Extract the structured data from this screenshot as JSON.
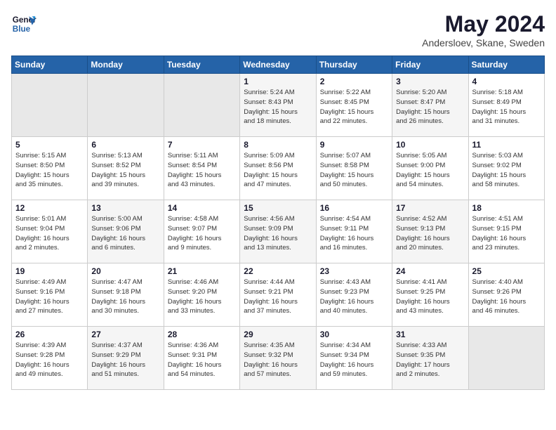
{
  "logo": {
    "line1": "General",
    "line2": "Blue"
  },
  "title": "May 2024",
  "location": "Andersloev, Skane, Sweden",
  "weekdays": [
    "Sunday",
    "Monday",
    "Tuesday",
    "Wednesday",
    "Thursday",
    "Friday",
    "Saturday"
  ],
  "weeks": [
    [
      {
        "day": "",
        "info": ""
      },
      {
        "day": "",
        "info": ""
      },
      {
        "day": "",
        "info": ""
      },
      {
        "day": "1",
        "info": "Sunrise: 5:24 AM\nSunset: 8:43 PM\nDaylight: 15 hours\nand 18 minutes."
      },
      {
        "day": "2",
        "info": "Sunrise: 5:22 AM\nSunset: 8:45 PM\nDaylight: 15 hours\nand 22 minutes."
      },
      {
        "day": "3",
        "info": "Sunrise: 5:20 AM\nSunset: 8:47 PM\nDaylight: 15 hours\nand 26 minutes."
      },
      {
        "day": "4",
        "info": "Sunrise: 5:18 AM\nSunset: 8:49 PM\nDaylight: 15 hours\nand 31 minutes."
      }
    ],
    [
      {
        "day": "5",
        "info": "Sunrise: 5:15 AM\nSunset: 8:50 PM\nDaylight: 15 hours\nand 35 minutes."
      },
      {
        "day": "6",
        "info": "Sunrise: 5:13 AM\nSunset: 8:52 PM\nDaylight: 15 hours\nand 39 minutes."
      },
      {
        "day": "7",
        "info": "Sunrise: 5:11 AM\nSunset: 8:54 PM\nDaylight: 15 hours\nand 43 minutes."
      },
      {
        "day": "8",
        "info": "Sunrise: 5:09 AM\nSunset: 8:56 PM\nDaylight: 15 hours\nand 47 minutes."
      },
      {
        "day": "9",
        "info": "Sunrise: 5:07 AM\nSunset: 8:58 PM\nDaylight: 15 hours\nand 50 minutes."
      },
      {
        "day": "10",
        "info": "Sunrise: 5:05 AM\nSunset: 9:00 PM\nDaylight: 15 hours\nand 54 minutes."
      },
      {
        "day": "11",
        "info": "Sunrise: 5:03 AM\nSunset: 9:02 PM\nDaylight: 15 hours\nand 58 minutes."
      }
    ],
    [
      {
        "day": "12",
        "info": "Sunrise: 5:01 AM\nSunset: 9:04 PM\nDaylight: 16 hours\nand 2 minutes."
      },
      {
        "day": "13",
        "info": "Sunrise: 5:00 AM\nSunset: 9:06 PM\nDaylight: 16 hours\nand 6 minutes."
      },
      {
        "day": "14",
        "info": "Sunrise: 4:58 AM\nSunset: 9:07 PM\nDaylight: 16 hours\nand 9 minutes."
      },
      {
        "day": "15",
        "info": "Sunrise: 4:56 AM\nSunset: 9:09 PM\nDaylight: 16 hours\nand 13 minutes."
      },
      {
        "day": "16",
        "info": "Sunrise: 4:54 AM\nSunset: 9:11 PM\nDaylight: 16 hours\nand 16 minutes."
      },
      {
        "day": "17",
        "info": "Sunrise: 4:52 AM\nSunset: 9:13 PM\nDaylight: 16 hours\nand 20 minutes."
      },
      {
        "day": "18",
        "info": "Sunrise: 4:51 AM\nSunset: 9:15 PM\nDaylight: 16 hours\nand 23 minutes."
      }
    ],
    [
      {
        "day": "19",
        "info": "Sunrise: 4:49 AM\nSunset: 9:16 PM\nDaylight: 16 hours\nand 27 minutes."
      },
      {
        "day": "20",
        "info": "Sunrise: 4:47 AM\nSunset: 9:18 PM\nDaylight: 16 hours\nand 30 minutes."
      },
      {
        "day": "21",
        "info": "Sunrise: 4:46 AM\nSunset: 9:20 PM\nDaylight: 16 hours\nand 33 minutes."
      },
      {
        "day": "22",
        "info": "Sunrise: 4:44 AM\nSunset: 9:21 PM\nDaylight: 16 hours\nand 37 minutes."
      },
      {
        "day": "23",
        "info": "Sunrise: 4:43 AM\nSunset: 9:23 PM\nDaylight: 16 hours\nand 40 minutes."
      },
      {
        "day": "24",
        "info": "Sunrise: 4:41 AM\nSunset: 9:25 PM\nDaylight: 16 hours\nand 43 minutes."
      },
      {
        "day": "25",
        "info": "Sunrise: 4:40 AM\nSunset: 9:26 PM\nDaylight: 16 hours\nand 46 minutes."
      }
    ],
    [
      {
        "day": "26",
        "info": "Sunrise: 4:39 AM\nSunset: 9:28 PM\nDaylight: 16 hours\nand 49 minutes."
      },
      {
        "day": "27",
        "info": "Sunrise: 4:37 AM\nSunset: 9:29 PM\nDaylight: 16 hours\nand 51 minutes."
      },
      {
        "day": "28",
        "info": "Sunrise: 4:36 AM\nSunset: 9:31 PM\nDaylight: 16 hours\nand 54 minutes."
      },
      {
        "day": "29",
        "info": "Sunrise: 4:35 AM\nSunset: 9:32 PM\nDaylight: 16 hours\nand 57 minutes."
      },
      {
        "day": "30",
        "info": "Sunrise: 4:34 AM\nSunset: 9:34 PM\nDaylight: 16 hours\nand 59 minutes."
      },
      {
        "day": "31",
        "info": "Sunrise: 4:33 AM\nSunset: 9:35 PM\nDaylight: 17 hours\nand 2 minutes."
      },
      {
        "day": "",
        "info": ""
      }
    ]
  ]
}
